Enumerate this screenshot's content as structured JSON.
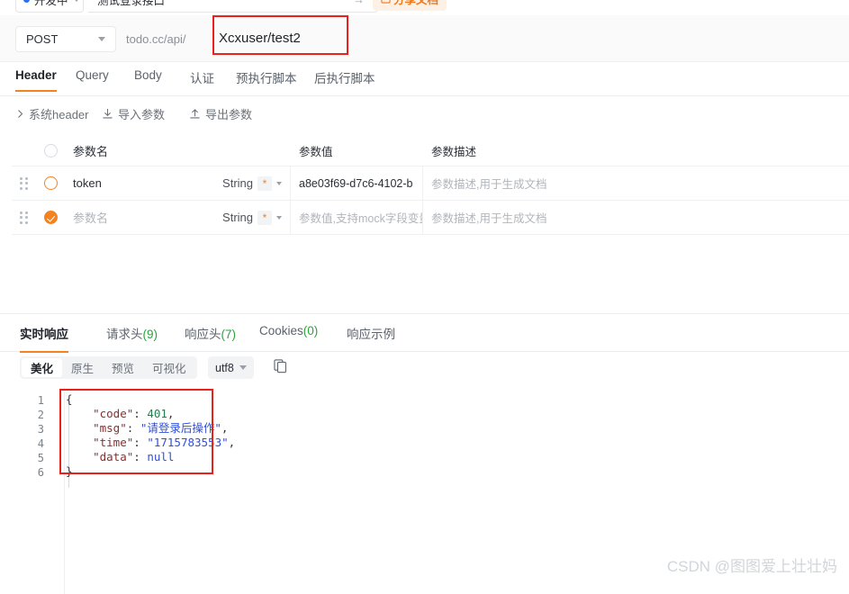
{
  "top": {
    "status_label": "开发中",
    "api_title": "测试登录接口",
    "send_arrow": "→",
    "share_label": "分享文档",
    "share_icon": "doc-share-icon"
  },
  "url_bar": {
    "method": "POST",
    "host_prefix": "todo.cc/api/",
    "path": "Xcxuser/test2"
  },
  "request_tabs": [
    {
      "label": "Header",
      "active": true
    },
    {
      "label": "Query",
      "active": false
    },
    {
      "label": "Body",
      "active": false
    },
    {
      "label": "认证",
      "active": false
    },
    {
      "label": "预执行脚本",
      "active": false
    },
    {
      "label": "后执行脚本",
      "active": false
    }
  ],
  "actions": [
    {
      "label": "系统header",
      "icon": "chevron-right-icon"
    },
    {
      "label": "导入参数",
      "icon": "import-download-icon"
    },
    {
      "label": "导出参数",
      "icon": "export-upload-icon"
    }
  ],
  "params_table": {
    "headers": {
      "name": "参数名",
      "value": "参数值",
      "desc": "参数描述"
    },
    "rows": [
      {
        "checked": "unchecked",
        "name": "token",
        "name_is_placeholder": false,
        "type": "String",
        "required_mark": "*",
        "value": "a8e03f69-d7c6-4102-b",
        "value_is_placeholder": false,
        "desc": "参数描述,用于生成文档",
        "desc_is_placeholder": true
      },
      {
        "checked": "checked",
        "name": "参数名",
        "name_is_placeholder": true,
        "type": "String",
        "required_mark": "*",
        "value": "参数值,支持mock字段变量",
        "value_is_placeholder": true,
        "desc": "参数描述,用于生成文档",
        "desc_is_placeholder": true
      }
    ]
  },
  "response_tabs": [
    {
      "label": "实时响应",
      "count": "",
      "active": true
    },
    {
      "label": "请求头",
      "count": "(9)",
      "active": false
    },
    {
      "label": "响应头",
      "count": "(7)",
      "active": false
    },
    {
      "label": "Cookies",
      "count": "(0)",
      "active": false
    },
    {
      "label": "响应示例",
      "count": "",
      "active": false
    }
  ],
  "viewer_toolbar": {
    "modes": [
      {
        "label": "美化",
        "active": true
      },
      {
        "label": "原生",
        "active": false
      },
      {
        "label": "预览",
        "active": false
      },
      {
        "label": "可视化",
        "active": false
      }
    ],
    "encoding": "utf8",
    "copy_icon": "copy-icon"
  },
  "code": {
    "line_numbers": [
      "1",
      "2",
      "3",
      "4",
      "5",
      "6"
    ],
    "lines": [
      [
        {
          "t": "{",
          "c": "punc"
        }
      ],
      [
        {
          "t": "    ",
          "c": "punc"
        },
        {
          "t": "\"code\"",
          "c": "key"
        },
        {
          "t": ": ",
          "c": "punc"
        },
        {
          "t": "401",
          "c": "num"
        },
        {
          "t": ",",
          "c": "punc"
        }
      ],
      [
        {
          "t": "    ",
          "c": "punc"
        },
        {
          "t": "\"msg\"",
          "c": "key"
        },
        {
          "t": ": ",
          "c": "punc"
        },
        {
          "t": "\"请登录后操作\"",
          "c": "str"
        },
        {
          "t": ",",
          "c": "punc"
        }
      ],
      [
        {
          "t": "    ",
          "c": "punc"
        },
        {
          "t": "\"time\"",
          "c": "key"
        },
        {
          "t": ": ",
          "c": "punc"
        },
        {
          "t": "\"1715783553\"",
          "c": "str"
        },
        {
          "t": ",",
          "c": "punc"
        }
      ],
      [
        {
          "t": "    ",
          "c": "punc"
        },
        {
          "t": "\"data\"",
          "c": "key"
        },
        {
          "t": ": ",
          "c": "punc"
        },
        {
          "t": "null",
          "c": "null"
        }
      ],
      [
        {
          "t": "}",
          "c": "punc"
        }
      ]
    ]
  },
  "annotations": {
    "url_box_color": "#e8211b",
    "json_box_color": "#e8211b"
  },
  "watermark": "CSDN @图图爱上壮壮妈"
}
